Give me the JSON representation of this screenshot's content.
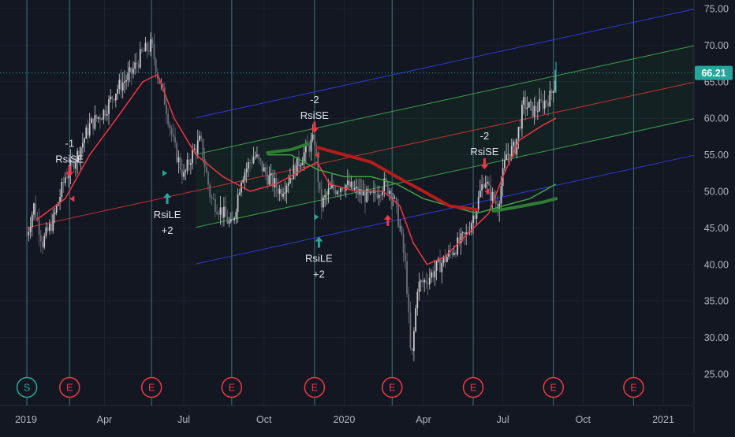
{
  "chart_data": {
    "type": "candlestick",
    "y_axis": {
      "min": 25,
      "max": 75,
      "ticks": [
        75,
        70,
        65,
        60,
        55,
        50,
        45,
        40,
        35,
        30,
        25
      ],
      "tick_labels": [
        "75.00",
        "70.00",
        "65.00",
        "60.00",
        "55.00",
        "50.00",
        "45.00",
        "40.00",
        "35.00",
        "30.00",
        "25.00"
      ]
    },
    "x_axis": {
      "labels": [
        "2019",
        "Apr",
        "Jul",
        "Oct",
        "2020",
        "Apr",
        "Jul",
        "Oct",
        "2021"
      ],
      "label_dates": [
        "2019-01-01",
        "2019-04-01",
        "2019-07-01",
        "2019-10-01",
        "2020-01-01",
        "2020-04-01",
        "2020-07-01",
        "2020-10-01",
        "2021-01-01"
      ]
    },
    "last_price": {
      "value": 66.21,
      "label": "66.21"
    },
    "price_path": [
      [
        "2019-01-02",
        44
      ],
      [
        "2019-01-10",
        48
      ],
      [
        "2019-01-20",
        43
      ],
      [
        "2019-02-01",
        46
      ],
      [
        "2019-02-15",
        52
      ],
      [
        "2019-03-01",
        55
      ],
      [
        "2019-03-15",
        59
      ],
      [
        "2019-04-01",
        61
      ],
      [
        "2019-04-15",
        64
      ],
      [
        "2019-05-01",
        66
      ],
      [
        "2019-05-15",
        69
      ],
      [
        "2019-05-25",
        70
      ],
      [
        "2019-06-01",
        66
      ],
      [
        "2019-06-10",
        62
      ],
      [
        "2019-06-20",
        56
      ],
      [
        "2019-07-01",
        52
      ],
      [
        "2019-07-10",
        55
      ],
      [
        "2019-07-20",
        57
      ],
      [
        "2019-08-01",
        49
      ],
      [
        "2019-08-15",
        47
      ],
      [
        "2019-08-25",
        45
      ],
      [
        "2019-09-05",
        52
      ],
      [
        "2019-09-20",
        55
      ],
      [
        "2019-10-05",
        52
      ],
      [
        "2019-10-20",
        50
      ],
      [
        "2019-11-05",
        53
      ],
      [
        "2019-11-20",
        56
      ],
      [
        "2019-11-28",
        57
      ],
      [
        "2019-12-05",
        48
      ],
      [
        "2019-12-15",
        50
      ],
      [
        "2020-01-01",
        51
      ],
      [
        "2020-01-15",
        50
      ],
      [
        "2020-02-01",
        49
      ],
      [
        "2020-02-15",
        51
      ],
      [
        "2020-02-25",
        50
      ],
      [
        "2020-03-05",
        45
      ],
      [
        "2020-03-12",
        39
      ],
      [
        "2020-03-18",
        26
      ],
      [
        "2020-03-25",
        37
      ],
      [
        "2020-04-05",
        38
      ],
      [
        "2020-04-20",
        40
      ],
      [
        "2020-05-05",
        42
      ],
      [
        "2020-05-20",
        44
      ],
      [
        "2020-06-01",
        48
      ],
      [
        "2020-06-10",
        52
      ],
      [
        "2020-06-15",
        50
      ],
      [
        "2020-06-25",
        48
      ],
      [
        "2020-07-05",
        55
      ],
      [
        "2020-07-15",
        56
      ],
      [
        "2020-07-25",
        62
      ],
      [
        "2020-08-05",
        61
      ],
      [
        "2020-08-15",
        62
      ],
      [
        "2020-08-25",
        63
      ],
      [
        "2020-08-31",
        66.21
      ]
    ],
    "overlays": [
      {
        "kind": "ema",
        "color": "#f23645",
        "points": [
          [
            "2019-01-12",
            46
          ],
          [
            "2019-02-15",
            49
          ],
          [
            "2019-03-15",
            55
          ],
          [
            "2019-04-15",
            60
          ],
          [
            "2019-05-15",
            65
          ],
          [
            "2019-06-01",
            66
          ],
          [
            "2019-06-20",
            60
          ],
          [
            "2019-07-15",
            55
          ],
          [
            "2019-08-15",
            52
          ],
          [
            "2019-09-15",
            50
          ],
          [
            "2019-10-15",
            51
          ],
          [
            "2019-11-15",
            53
          ],
          [
            "2019-12-01",
            54
          ],
          [
            "2019-12-15",
            51
          ],
          [
            "2020-01-15",
            50
          ],
          [
            "2020-02-15",
            50
          ],
          [
            "2020-03-05",
            48
          ],
          [
            "2020-03-20",
            43
          ],
          [
            "2020-04-05",
            40
          ],
          [
            "2020-04-25",
            41
          ],
          [
            "2020-05-20",
            44
          ],
          [
            "2020-06-15",
            47
          ],
          [
            "2020-07-01",
            52
          ],
          [
            "2020-07-20",
            57
          ],
          [
            "2020-08-15",
            59
          ],
          [
            "2020-08-31",
            60
          ]
        ]
      },
      {
        "kind": "sma_long",
        "color": "#43a047",
        "points": [
          [
            "2019-10-05",
            55
          ],
          [
            "2019-11-01",
            55
          ],
          [
            "2019-12-01",
            53
          ],
          [
            "2020-01-01",
            52
          ],
          [
            "2020-02-01",
            52
          ],
          [
            "2020-03-01",
            51
          ],
          [
            "2020-04-01",
            49
          ],
          [
            "2020-05-01",
            48
          ],
          [
            "2020-06-01",
            47
          ],
          [
            "2020-07-01",
            48
          ],
          [
            "2020-08-01",
            49
          ],
          [
            "2020-08-31",
            51
          ]
        ]
      }
    ],
    "regression_channel": {
      "start": [
        "2019-01-01",
        45
      ],
      "end": [
        "2020-12-31",
        64
      ],
      "bands": [
        -10,
        -5,
        0,
        5,
        10
      ]
    },
    "signals": [
      {
        "date": "2019-02-20",
        "price": 52,
        "dir": "down",
        "text": [
          "-1",
          "RsiSE"
        ]
      },
      {
        "date": "2019-06-12",
        "price": 50,
        "dir": "up",
        "text": [
          "RsiLE",
          "+2"
        ]
      },
      {
        "date": "2019-11-28",
        "price": 58,
        "dir": "down",
        "text": [
          "-2",
          "RsiSE"
        ]
      },
      {
        "date": "2019-12-03",
        "price": 44,
        "dir": "up",
        "text": [
          "RsiLE",
          "+2"
        ]
      },
      {
        "date": "2020-02-20",
        "price": 47,
        "dir": "up",
        "text": []
      },
      {
        "date": "2020-06-10",
        "price": 53,
        "dir": "down",
        "text": [
          "-2",
          "RsiSE"
        ]
      }
    ],
    "events": [
      {
        "date": "2019-01-02",
        "label": "S"
      },
      {
        "date": "2019-02-20",
        "label": "E"
      },
      {
        "date": "2019-05-25",
        "label": "E"
      },
      {
        "date": "2019-08-25",
        "label": "E"
      },
      {
        "date": "2019-11-28",
        "label": "E"
      },
      {
        "date": "2020-02-25",
        "label": "E"
      },
      {
        "date": "2020-05-28",
        "label": "E"
      },
      {
        "date": "2020-08-28",
        "label": "E"
      },
      {
        "date": "2020-11-28",
        "label": "E"
      }
    ]
  }
}
